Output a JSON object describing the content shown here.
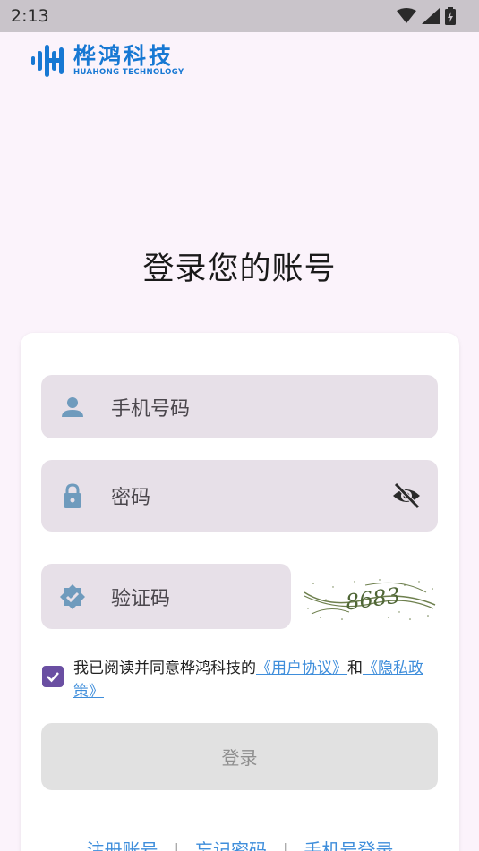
{
  "status_bar": {
    "time": "2:13"
  },
  "logo": {
    "cn": "桦鸿科技",
    "en": "HUAHONG TECHNOLOGY",
    "color": "#1778d3"
  },
  "title": "登录您的账号",
  "form": {
    "phone_placeholder": "手机号码",
    "password_placeholder": "密码",
    "captcha_placeholder": "验证码",
    "captcha_image_text": "8683"
  },
  "agreement": {
    "prefix": "我已阅读并同意桦鸿科技的",
    "user_agreement": "《用户协议》",
    "and": "和",
    "privacy_policy": "《隐私政策》",
    "checked": true
  },
  "login_button": "登录",
  "links": {
    "register": "注册账号",
    "forgot": "忘记密码",
    "phone_login": "手机号登录",
    "separator": "|"
  },
  "colors": {
    "accent": "#6a4fa2",
    "link": "#3f8edb",
    "field_bg": "#e7e0e8",
    "icon": "#6f9bbd"
  }
}
